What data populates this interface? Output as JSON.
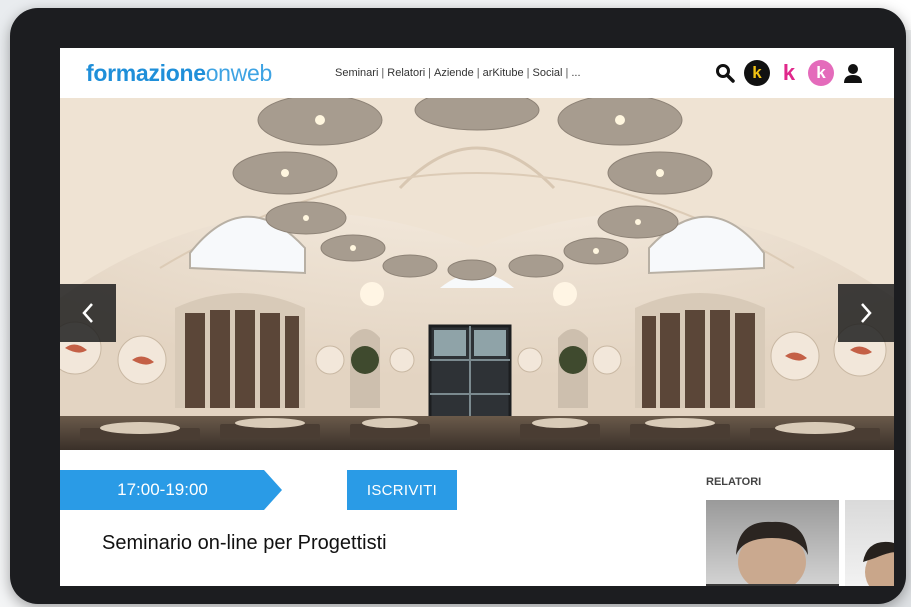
{
  "header": {
    "logo_bold": "formazione",
    "logo_light": "onweb",
    "nav": [
      "Seminari",
      "Relatori",
      "Aziende",
      "arKitube",
      "Social",
      "..."
    ]
  },
  "icons": [
    "search-icon",
    "k-yellow-circle-icon",
    "k-pink-icon",
    "k-pink-circle-icon",
    "user-icon"
  ],
  "event": {
    "time": "17:00-19:00",
    "register_label": "ISCRIVITI",
    "title": "Seminario on-line per Progettisti"
  },
  "sidebar": {
    "relatori_label": "RELATORI"
  },
  "colors": {
    "brand_blue": "#1f8fd9",
    "badge_blue": "#2a9be6",
    "pink": "#e0288b",
    "frame": "#1c1d20"
  }
}
